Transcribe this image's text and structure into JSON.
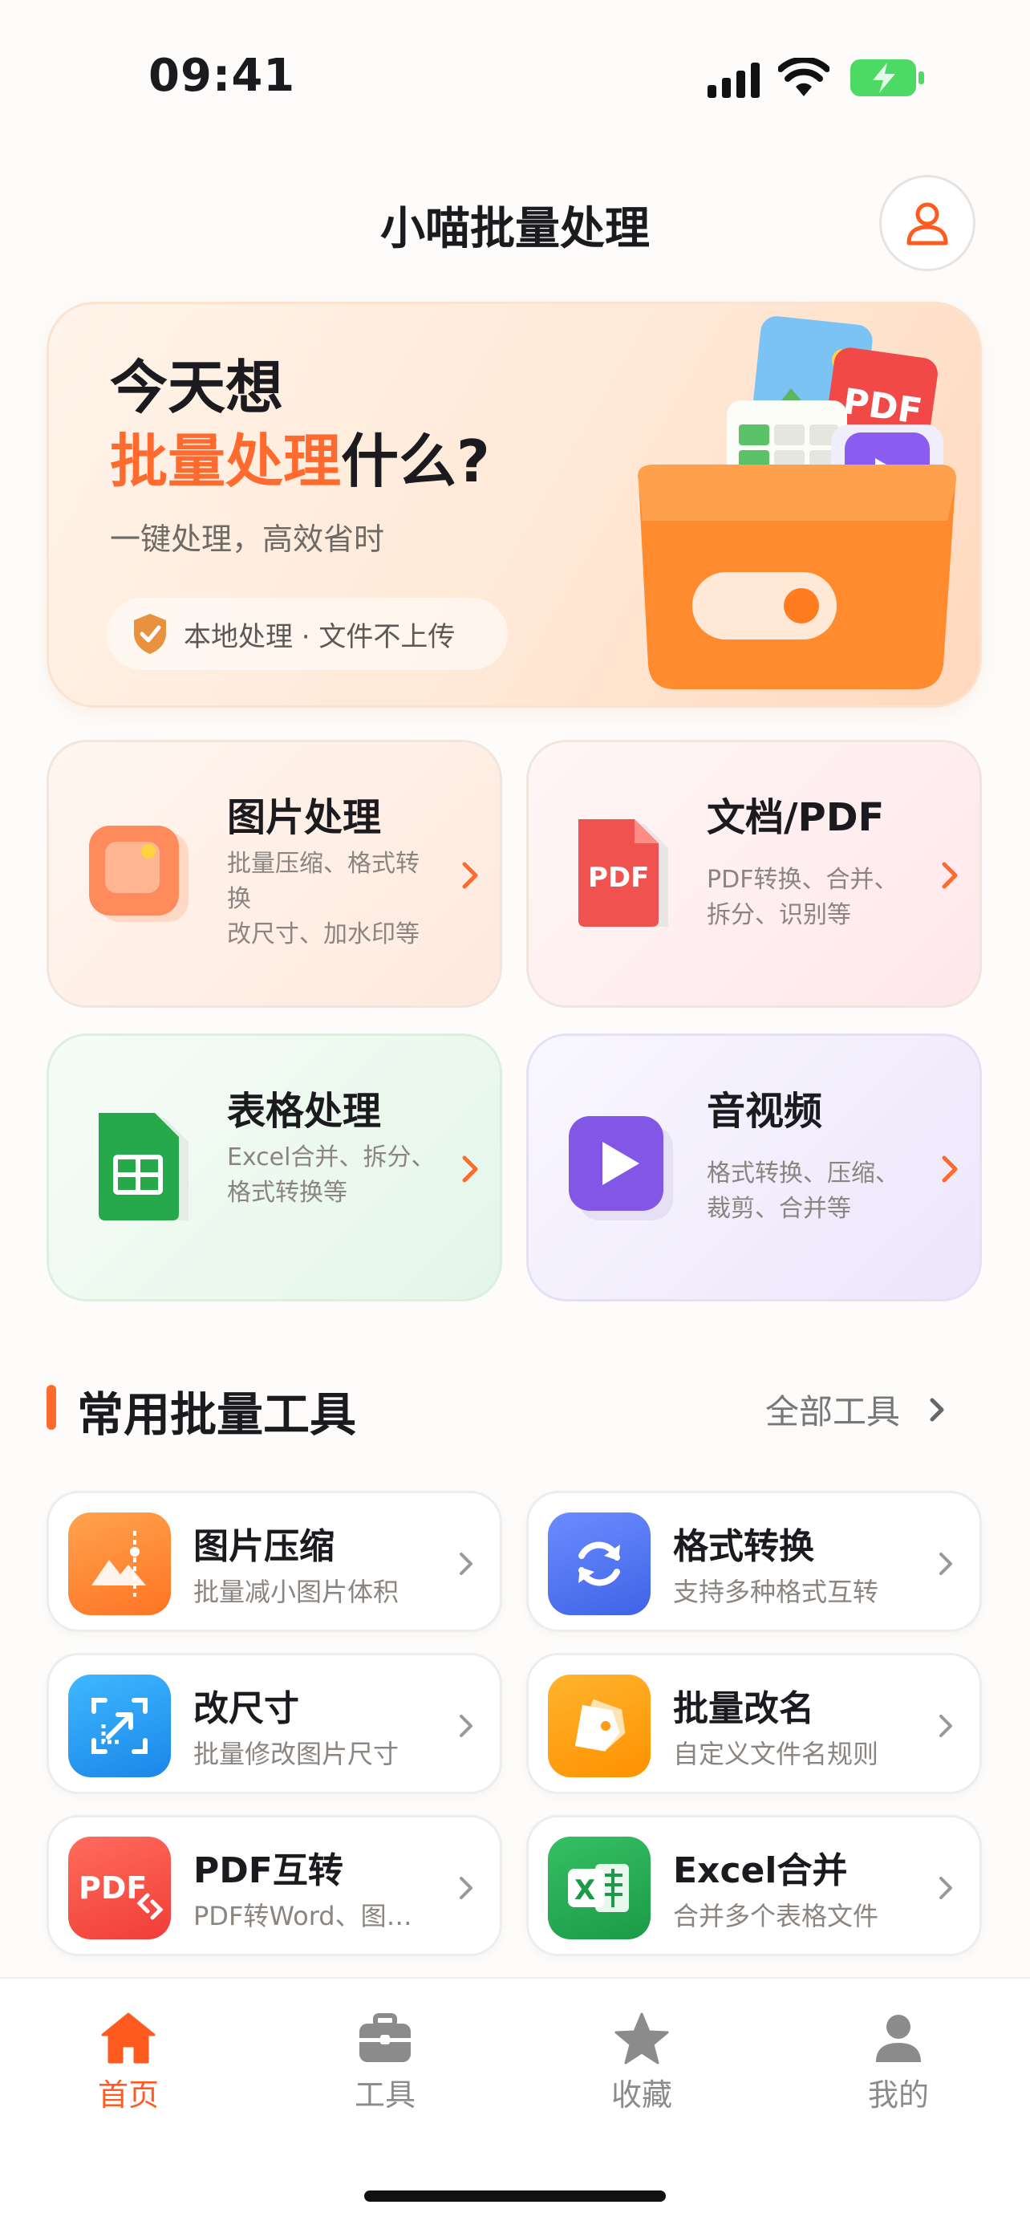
{
  "status_bar": {
    "time": "09:41",
    "icons": [
      "signal-icon",
      "wifi-icon",
      "battery-charging-icon"
    ]
  },
  "header": {
    "title": "小喵批量处理",
    "profile_icon": "user-outline-icon"
  },
  "hero": {
    "line1": "今天想",
    "line2_highlight": "批量处理",
    "line2_rest": "什么?",
    "subtitle": "一键处理，高效省时",
    "badge": "本地处理 · 文件不上传",
    "accent": "#ff6a2e"
  },
  "categories": [
    {
      "title": "图片处理",
      "desc_line1": "批量压缩、格式转换",
      "desc_line2": "改尺寸、加水印等",
      "icon": "image-icon"
    },
    {
      "title": "文档/PDF",
      "desc_line1": "PDF转换、合并、",
      "desc_line2": "拆分、识别等",
      "icon": "pdf-icon"
    },
    {
      "title": "表格处理",
      "desc_line1": "Excel合并、拆分、",
      "desc_line2": "格式转换等",
      "icon": "spreadsheet-icon"
    },
    {
      "title": "音视频",
      "desc_line1": "格式转换、压缩、",
      "desc_line2": "裁剪、合并等",
      "icon": "video-play-icon"
    }
  ],
  "section": {
    "title": "常用批量工具",
    "more": "全部工具"
  },
  "tools": [
    {
      "title": "图片压缩",
      "desc": "批量减小图片体积",
      "icon": "image-compress-icon"
    },
    {
      "title": "格式转换",
      "desc": "支持多种格式互转",
      "icon": "refresh-icon"
    },
    {
      "title": "改尺寸",
      "desc": "批量修改图片尺寸",
      "icon": "resize-icon"
    },
    {
      "title": "批量改名",
      "desc": "自定义文件名规则",
      "icon": "tags-icon"
    },
    {
      "title": "PDF互转",
      "desc": "PDF转Word、图…",
      "icon": "pdf-convert-icon"
    },
    {
      "title": "Excel合并",
      "desc": "合并多个表格文件",
      "icon": "excel-icon"
    }
  ],
  "tabs": [
    {
      "label": "首页",
      "icon": "home-icon",
      "active": true
    },
    {
      "label": "工具",
      "icon": "toolbox-icon",
      "active": false
    },
    {
      "label": "收藏",
      "icon": "star-icon",
      "active": false
    },
    {
      "label": "我的",
      "icon": "user-icon",
      "active": false
    }
  ]
}
